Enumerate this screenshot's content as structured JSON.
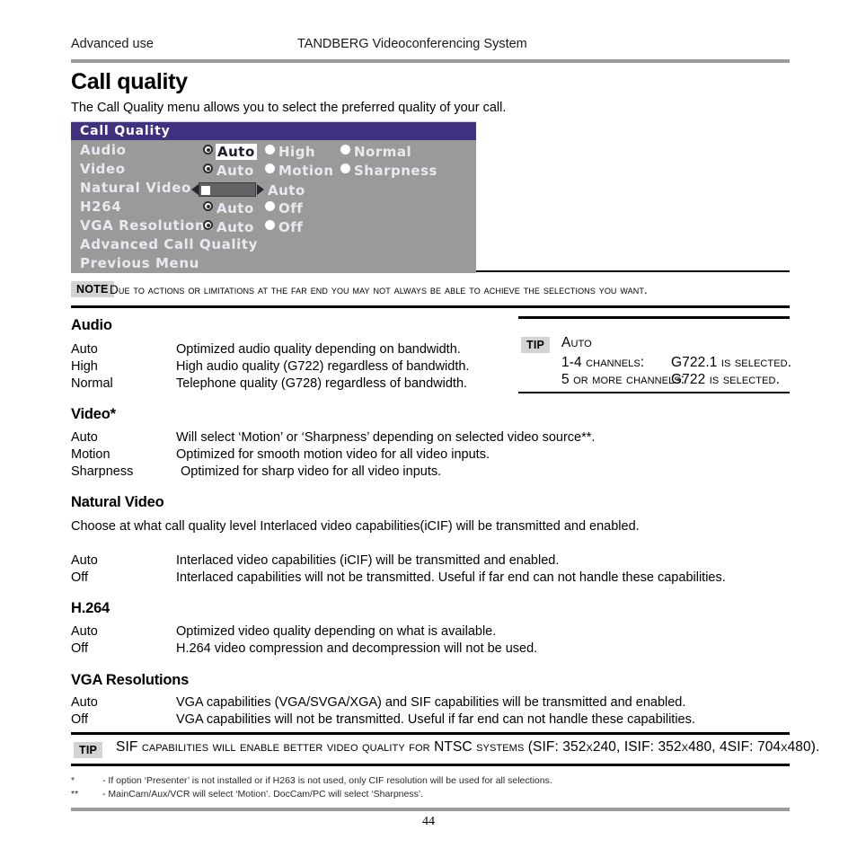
{
  "header": {
    "left": "Advanced use",
    "center": "TANDBERG Videoconferencing System"
  },
  "title": "Call quality",
  "intro": "The Call Quality menu allows you to select the preferred quality of your call.",
  "menu": {
    "title": "Call Quality",
    "colors": {
      "titlebar": "#3f3080",
      "body": "#9a9a9a",
      "label_text": "#e9e9ef",
      "highlight_bg": "#ffffff"
    },
    "rows": [
      {
        "label": "Audio",
        "type": "radio",
        "options": [
          {
            "text": "Auto",
            "selected": true,
            "highlighted": true
          },
          {
            "text": "High",
            "selected": false,
            "highlighted": false
          },
          {
            "text": "Normal",
            "selected": false,
            "highlighted": false
          }
        ]
      },
      {
        "label": "Video",
        "type": "radio",
        "options": [
          {
            "text": "Auto",
            "selected": true,
            "highlighted": false
          },
          {
            "text": "Motion",
            "selected": false,
            "highlighted": false
          },
          {
            "text": "Sharpness",
            "selected": false,
            "highlighted": false
          }
        ]
      },
      {
        "label": "Natural Video",
        "type": "slider",
        "value_text": "Auto"
      },
      {
        "label": "H264",
        "type": "radio",
        "options": [
          {
            "text": "Auto",
            "selected": true,
            "highlighted": false
          },
          {
            "text": "Off",
            "selected": false,
            "highlighted": false
          }
        ]
      },
      {
        "label": "VGA Resolutions",
        "type": "radio",
        "options": [
          {
            "text": "Auto",
            "selected": true,
            "highlighted": false
          },
          {
            "text": "Off",
            "selected": false,
            "highlighted": false
          }
        ]
      },
      {
        "label": "Advanced Call Quality",
        "type": "link"
      },
      {
        "label": "Previous Menu",
        "type": "link"
      }
    ]
  },
  "note": {
    "badge": "NOTE",
    "text": "Due to actions or limitations at the far end you may not always be able to achieve the selections you want."
  },
  "sections": {
    "audio": {
      "heading": "Audio",
      "rows": [
        {
          "term": "Auto",
          "desc": "Optimized audio quality depending on bandwidth."
        },
        {
          "term": "High",
          "desc": "High audio quality (G722) regardless of bandwidth."
        },
        {
          "term": "Normal",
          "desc": "Telephone quality (G728) regardless of bandwidth."
        }
      ]
    },
    "video": {
      "heading": "Video*",
      "rows": [
        {
          "term": "Auto",
          "desc": "Will select ‘Motion’ or ‘Sharpness’ depending on selected video source**."
        },
        {
          "term": "Motion",
          "desc": "Optimized for smooth motion video for all video inputs."
        },
        {
          "term": "Sharpness",
          "desc": "Optimized for sharp video for all video inputs."
        }
      ]
    },
    "natural_video": {
      "heading": "Natural Video",
      "paragraph": "Choose at what call quality level Interlaced video capabilities(iCIF) will be transmitted and enabled.",
      "rows": [
        {
          "term": "Auto",
          "desc": "Interlaced video capabilities (iCIF) will be transmitted and enabled."
        },
        {
          "term": "Off",
          "desc": "Interlaced capabilities will not be transmitted. Useful if far end can not handle these capabilities."
        }
      ]
    },
    "h264": {
      "heading": "H.264",
      "rows": [
        {
          "term": "Auto",
          "desc": "Optimized video quality depending on what is available."
        },
        {
          "term": "Off",
          "desc": "H.264 video compression and decompression will not be used."
        }
      ]
    },
    "vga": {
      "heading": "VGA Resolutions",
      "rows": [
        {
          "term": "Auto",
          "desc": "VGA capabilities (VGA/SVGA/XGA) and SIF capabilities will be transmitted and enabled."
        },
        {
          "term": "Off",
          "desc": "VGA capabilities will not be transmitted. Useful if far end can not handle these capabilities."
        }
      ]
    }
  },
  "tip_audio": {
    "badge": "TIP",
    "line1": "Auto",
    "line2_label": "1-4 channels:",
    "line2_value": "G722.1 is selected.",
    "line3_label": "5 or more channels:",
    "line3_value": "G722 is selected."
  },
  "tip_bottom": {
    "badge": "TIP",
    "text": "SIF capabilities will enable better video quality for NTSC systems (SIF: 352x240, ISIF: 352x480, 4SIF: 704x480)."
  },
  "footnotes": [
    {
      "mark": "*",
      "text": "- If  option ‘Presenter’ is not installed or if H263 is not used, only CIF resolution will be used for all selections."
    },
    {
      "mark": "**",
      "text": "- MainCam/Aux/VCR will select ‘Motion’. DocCam/PC will select ‘Sharpness’."
    }
  ],
  "page_number": "44"
}
